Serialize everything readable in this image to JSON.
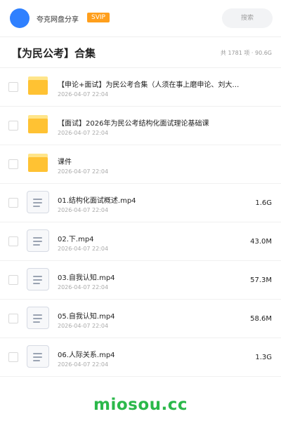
{
  "header": {
    "sharer_name": "夸克网盘分享",
    "badge": "SVIP",
    "search_placeholder": "搜索"
  },
  "folder": {
    "title": "【为民公考】合集",
    "summary": "共 1781 项 · 90.6G"
  },
  "items": [
    {
      "type": "folder",
      "name": "【申论+面试】为民公考合集（人须在事上磨申论、刘大…",
      "date": "2026-04-07 22:04",
      "size": ""
    },
    {
      "type": "folder",
      "name": "【面试】2026年为民公考结构化面试理论基础课",
      "date": "2026-04-07 22:04",
      "size": ""
    },
    {
      "type": "folder",
      "name": "课件",
      "date": "2026-04-07 22:04",
      "size": ""
    },
    {
      "type": "file",
      "name": "01.结构化面试概述.mp4",
      "date": "2026-04-07 22:04",
      "size": "1.6G"
    },
    {
      "type": "file",
      "name": "02.下.mp4",
      "date": "2026-04-07 22:04",
      "size": "43.0M"
    },
    {
      "type": "file",
      "name": "03.自我认知.mp4",
      "date": "2026-04-07 22:04",
      "size": "57.3M"
    },
    {
      "type": "file",
      "name": "05.自我认知.mp4",
      "date": "2026-04-07 22:04",
      "size": "58.6M"
    },
    {
      "type": "file",
      "name": "06.人际关系.mp4",
      "date": "2026-04-07 22:04",
      "size": "1.3G"
    }
  ],
  "watermark": "miosou.cc",
  "icons": {
    "folder": "folder-icon",
    "file": "video-file-icon"
  },
  "colors": {
    "accent": "#2f80ff",
    "badge": "#ff9f1c",
    "folder": "#ffc233",
    "watermark": "#2bb84a"
  }
}
